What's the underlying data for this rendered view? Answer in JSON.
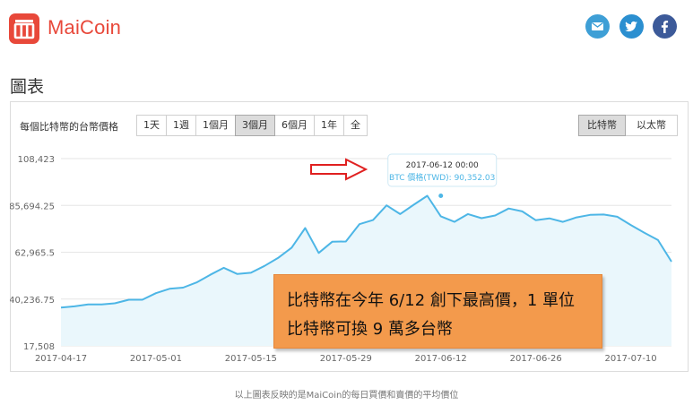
{
  "header": {
    "logo_text": "MaiCoin",
    "social": [
      {
        "icon": "email-icon",
        "color": "#3e9fd6"
      },
      {
        "icon": "twitter-icon",
        "color": "#2b8fd0"
      },
      {
        "icon": "facebook-icon",
        "color": "#3c5a99"
      }
    ]
  },
  "page_title": "圖表",
  "panel": {
    "label": "每個比特幣的台幣價格",
    "ranges": [
      "1天",
      "1週",
      "1個月",
      "3個月",
      "6個月",
      "1年",
      "全"
    ],
    "active_range": "3個月",
    "currencies": [
      "比特幣",
      "以太幣"
    ],
    "active_currency": "比特幣"
  },
  "tooltip": {
    "date": "2017-06-12 00:00",
    "value": "BTC 價格(TWD): 90,352.03"
  },
  "callout": {
    "line1": "比特幣在今年 6/12 創下最高價，1 單位",
    "line2": "比特幣可換 9 萬多台幣"
  },
  "footer_note": "以上圖表反映的是MaiCoin的每日買價和賣價的平均價位",
  "chart_data": {
    "type": "area",
    "yticks": [
      "108,423",
      "85,694.25",
      "62,965.5",
      "40,236.75",
      "17,508"
    ],
    "xticks": [
      "2017-04-17",
      "2017-05-01",
      "2017-05-15",
      "2017-05-29",
      "2017-06-12",
      "2017-06-26",
      "2017-07-10"
    ],
    "ylim": [
      17508,
      108423
    ],
    "xlim": [
      "2017-04-17",
      "2017-07-16"
    ],
    "grid": true,
    "line_color": "#4db6e6",
    "fill_color": "#eaf7fc",
    "highlight": {
      "x": "2017-06-12",
      "y": 90352.03
    },
    "x": [
      "2017-04-17",
      "2017-04-19",
      "2017-04-21",
      "2017-04-23",
      "2017-04-25",
      "2017-04-27",
      "2017-04-29",
      "2017-05-01",
      "2017-05-03",
      "2017-05-05",
      "2017-05-07",
      "2017-05-09",
      "2017-05-11",
      "2017-05-13",
      "2017-05-15",
      "2017-05-17",
      "2017-05-19",
      "2017-05-21",
      "2017-05-23",
      "2017-05-25",
      "2017-05-27",
      "2017-05-29",
      "2017-05-31",
      "2017-06-02",
      "2017-06-04",
      "2017-06-06",
      "2017-06-08",
      "2017-06-10",
      "2017-06-12",
      "2017-06-14",
      "2017-06-16",
      "2017-06-18",
      "2017-06-20",
      "2017-06-22",
      "2017-06-24",
      "2017-06-26",
      "2017-06-28",
      "2017-06-30",
      "2017-07-02",
      "2017-07-04",
      "2017-07-06",
      "2017-07-08",
      "2017-07-10",
      "2017-07-12",
      "2017-07-14",
      "2017-07-16"
    ],
    "values": [
      36100,
      36700,
      37600,
      37600,
      38200,
      39900,
      39900,
      43100,
      45200,
      45800,
      48300,
      52000,
      55400,
      52400,
      53000,
      56300,
      60200,
      65200,
      74700,
      62600,
      68100,
      68200,
      76600,
      78600,
      85700,
      81500,
      86000,
      90352,
      80400,
      77700,
      81500,
      79500,
      80800,
      84200,
      82800,
      78500,
      79400,
      77700,
      79900,
      81100,
      81300,
      80200,
      76200,
      72400,
      68900,
      58400
    ]
  }
}
